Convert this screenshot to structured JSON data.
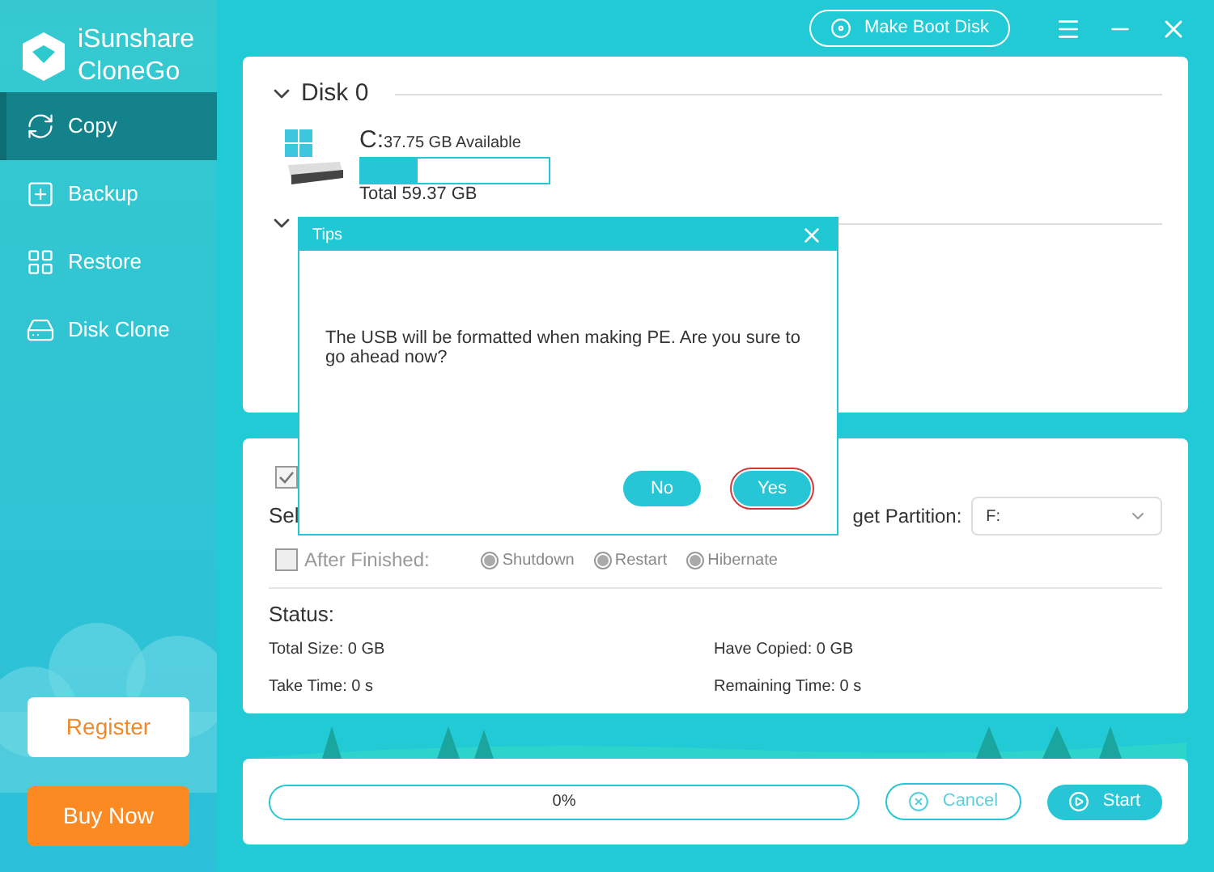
{
  "app": {
    "name_line1": "iSunshare",
    "name_line2": "CloneGo"
  },
  "sidebar": {
    "items": [
      {
        "label": "Copy",
        "kind": "copy",
        "selected": true
      },
      {
        "label": "Backup",
        "kind": "backup",
        "selected": false
      },
      {
        "label": "Restore",
        "kind": "restore",
        "selected": false
      },
      {
        "label": "Disk Clone",
        "kind": "clone",
        "selected": false
      }
    ],
    "register_button": "Register",
    "buy_button": "Buy Now"
  },
  "top_bar": {
    "boot_button": "Make Boot Disk"
  },
  "disks": [
    {
      "title": "Disk 0",
      "expanded": true,
      "partitions": [
        {
          "letter": "C:",
          "available": "37.75 GB Available",
          "level": 0.3,
          "total": "Total 59.37 GB"
        }
      ]
    },
    {
      "expanded": true
    }
  ],
  "options": {
    "copy_checkbox": {
      "checked": true
    },
    "select_label": "Sel",
    "target_label": "get Partition:",
    "target_value": "F:",
    "after_finished": {
      "label": "After Finished:",
      "checked": false,
      "options": [
        {
          "label": "Shutdown",
          "disabled": true
        },
        {
          "label": "Restart",
          "disabled": true
        },
        {
          "label": "Hibernate",
          "disabled": true
        }
      ]
    }
  },
  "status": {
    "title": "Status:",
    "items": [
      "Total Size: 0 GB",
      "Have Copied: 0 GB",
      "Take Time: 0 s",
      "Remaining Time: 0 s"
    ]
  },
  "progress": {
    "level": 0,
    "label": "0%"
  },
  "actions": {
    "cancel": "Cancel",
    "start": "Start"
  },
  "dialog": {
    "title": "Tips",
    "message": "The USB will be formatted when making PE. Are you sure to go ahead now?",
    "buttons": [
      {
        "label": "No",
        "selected": false
      },
      {
        "label": "Yes",
        "selected": true
      }
    ]
  }
}
